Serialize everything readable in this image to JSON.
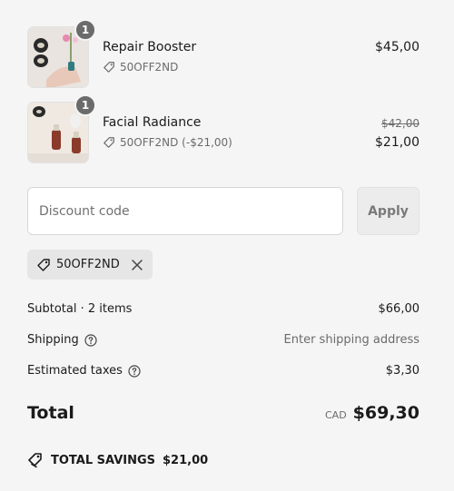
{
  "items": [
    {
      "name": "Repair Booster",
      "quantity": "1",
      "discount_code": "50OFF2ND",
      "price": "$45,00",
      "image_icon": "product-thumbnail"
    },
    {
      "name": "Facial Radiance",
      "quantity": "1",
      "discount_code": "50OFF2ND (-$21,00)",
      "original_price": "$42,00",
      "price": "$21,00",
      "image_icon": "product-thumbnail"
    }
  ],
  "discount": {
    "placeholder": "Discount code",
    "apply_label": "Apply",
    "applied_code": "50OFF2ND"
  },
  "summary": {
    "subtotal_label": "Subtotal · 2 items",
    "subtotal_value": "$66,00",
    "shipping_label": "Shipping",
    "shipping_value": "Enter shipping address",
    "taxes_label": "Estimated taxes",
    "taxes_value": "$3,30",
    "total_label": "Total",
    "currency": "CAD",
    "total_value": "$69,30",
    "savings_label": "TOTAL SAVINGS",
    "savings_value": "$21,00"
  },
  "colors": {
    "background": "#f5f5f5",
    "text": "#1a1a1a",
    "muted": "#6b6b6b",
    "badge": "#6b6b6b"
  }
}
